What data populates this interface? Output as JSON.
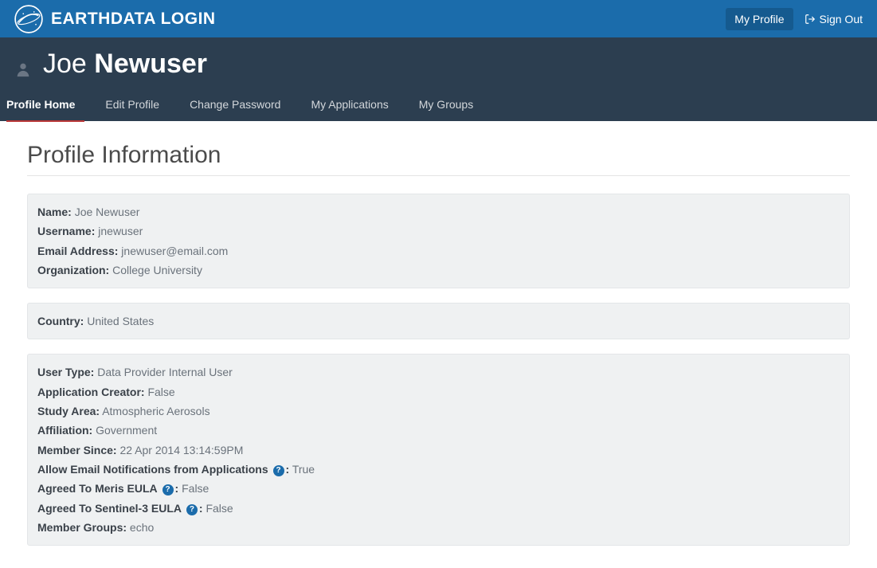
{
  "header": {
    "brand": "EARTHDATA LOGIN",
    "my_profile": "My Profile",
    "sign_out": "Sign Out"
  },
  "subheader": {
    "first_name": "Joe",
    "last_name": "Newuser",
    "tabs": [
      {
        "label": "Profile Home",
        "active": true
      },
      {
        "label": "Edit Profile",
        "active": false
      },
      {
        "label": "Change Password",
        "active": false
      },
      {
        "label": "My Applications",
        "active": false
      },
      {
        "label": "My Groups",
        "active": false
      }
    ]
  },
  "page": {
    "title": "Profile Information"
  },
  "panel1": {
    "name_label": "Name:",
    "name_value": "Joe Newuser",
    "username_label": "Username:",
    "username_value": "jnewuser",
    "email_label": "Email Address:",
    "email_value": "jnewuser@email.com",
    "org_label": "Organization:",
    "org_value": "College University"
  },
  "panel2": {
    "country_label": "Country:",
    "country_value": "United States"
  },
  "panel3": {
    "usertype_label": "User Type:",
    "usertype_value": "Data Provider Internal User",
    "appcreator_label": "Application Creator:",
    "appcreator_value": "False",
    "study_label": "Study Area:",
    "study_value": "Atmospheric Aerosols",
    "affil_label": "Affiliation:",
    "affil_value": "Government",
    "member_since_label": "Member Since:",
    "member_since_value": "22 Apr 2014 13:14:59PM",
    "allow_email_label_pre": "Allow Email Notifications from Applications",
    "allow_email_label_post": ":",
    "allow_email_value": "True",
    "meris_label_pre": "Agreed To Meris EULA",
    "meris_label_post": ":",
    "meris_value": "False",
    "sentinel_label_pre": "Agreed To Sentinel-3 EULA",
    "sentinel_label_post": ":",
    "sentinel_value": "False",
    "groups_label": "Member Groups:",
    "groups_value": "echo"
  }
}
